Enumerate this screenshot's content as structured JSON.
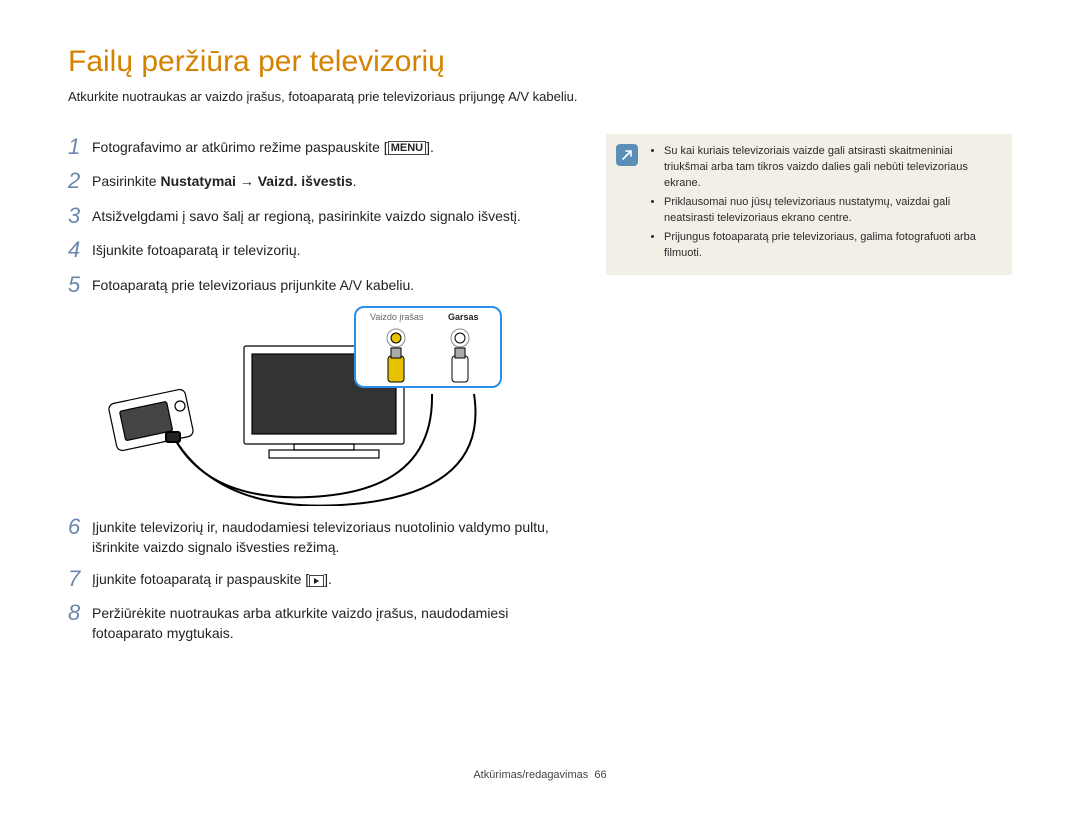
{
  "title": "Failų peržiūra per televizorių",
  "subtitle": "Atkurkite nuotraukas ar vaizdo įrašus, fotoaparatą prie televizoriaus prijungę A/V kabeliu.",
  "steps": {
    "s1_pre": "Fotografavimo ar atkūrimo režime paspauskite [",
    "s1_btn": "MENU",
    "s1_post": "].",
    "s2_pre": "Pasirinkite ",
    "s2_b": "Nustatymai → Vaizd. išvestis",
    "s2_post": ".",
    "s3": "Atsižvelgdami į savo šalį ar regioną, pasirinkite vaizdo signalo išvestį.",
    "s4": "Išjunkite fotoaparatą ir televizorių.",
    "s5": "Fotoaparatą prie televizoriaus prijunkite A/V kabeliu.",
    "s6": "Įjunkite televizorių ir, naudodamiesi televizoriaus nuotolinio valdymo pultu, išrinkite vaizdo signalo išvesties režimą.",
    "s7_pre": "Įjunkite fotoaparatą ir paspauskite [",
    "s7_post": "].",
    "s8": "Peržiūrėkite nuotraukas arba atkurkite vaizdo įrašus, naudodamiesi fotoaparato mygtukais."
  },
  "diagram_labels": {
    "video": "Vaizdo įrašas",
    "audio": "Garsas"
  },
  "notes": [
    "Su kai kuriais televizoriais vaizde gali atsirasti skaitmeniniai triukšmai arba tam tikros vaizdo dalies gali nebūti televizoriaus ekrane.",
    "Priklausomai nuo jūsų televizoriaus nustatymų, vaizdai gali neatsirasti televizoriaus ekrano centre.",
    "Prijungus fotoaparatą prie televizoriaus, galima fotografuoti arba filmuoti."
  ],
  "footer": {
    "section": "Atkūrimas/redagavimas",
    "page": "66"
  }
}
